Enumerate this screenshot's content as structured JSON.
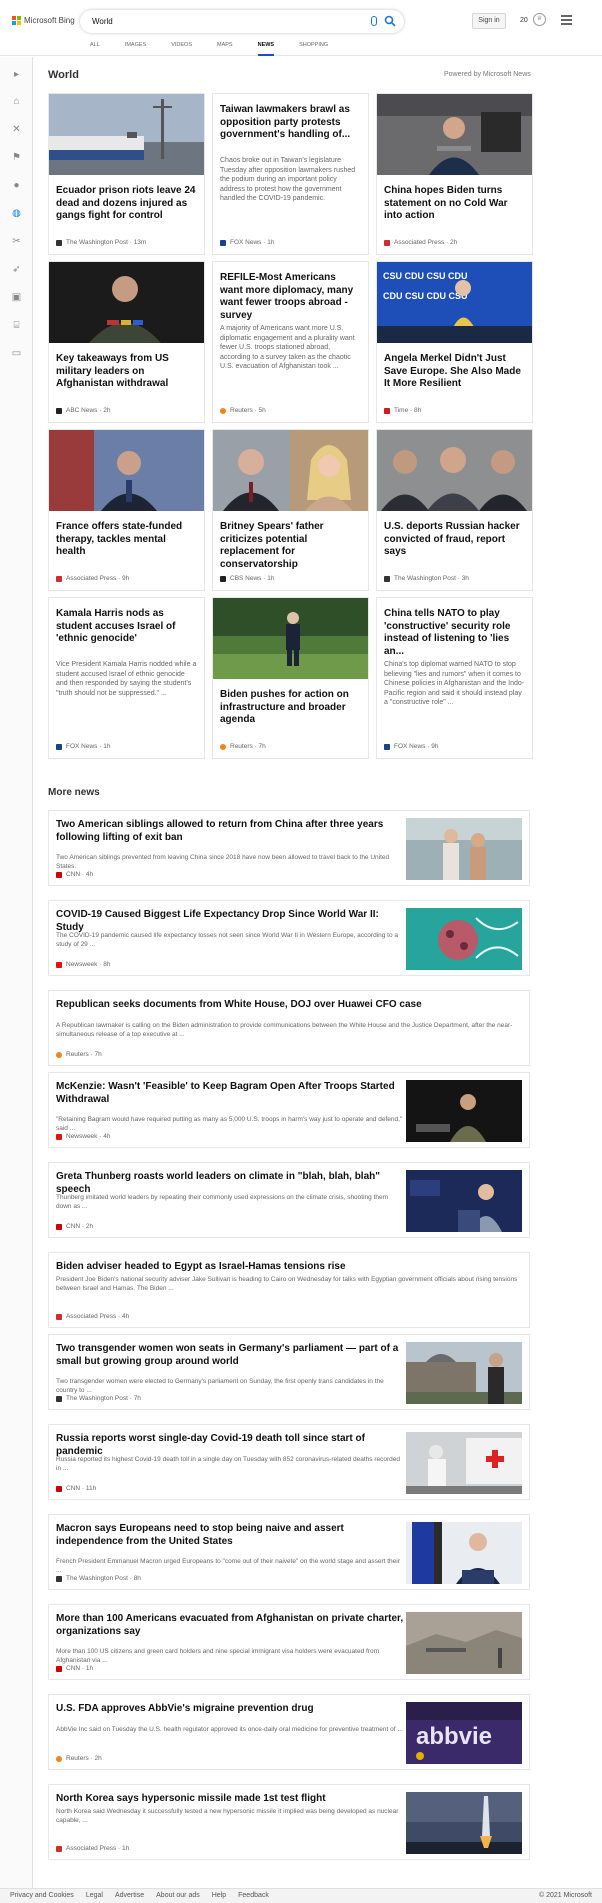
{
  "header": {
    "logo_text": "Microsoft Bing",
    "search_value": "World",
    "signin_label": "Sign in",
    "rewards_count": "20",
    "tabs": [
      {
        "label": "ALL"
      },
      {
        "label": "IMAGES"
      },
      {
        "label": "VIDEOS"
      },
      {
        "label": "MAPS"
      },
      {
        "label": "NEWS"
      },
      {
        "label": "SHOPPING"
      }
    ]
  },
  "section": {
    "title": "World",
    "powered_by": "Powered by Microsoft News",
    "more_title": "More news"
  },
  "top_cards": [
    {
      "headline": "Ecuador prison riots leave 24 dead and dozens injured as gangs fight for control",
      "snippet": "",
      "source": "The Washington Post",
      "time": "13m"
    },
    {
      "headline": "Taiwan lawmakers brawl as opposition party protests government's handling of...",
      "snippet": "Chaos broke out in Taiwan's legislature Tuesday after opposition lawmakers rushed the podium during an important policy address to protest how the government handled the COVID-19 pandemic.",
      "source": "FOX News",
      "time": "1h"
    },
    {
      "headline": "China hopes Biden turns statement on no Cold War into action",
      "snippet": "",
      "source": "Associated Press",
      "time": "2h"
    },
    {
      "headline": "Key takeaways from US military leaders on Afghanistan withdrawal",
      "snippet": "",
      "source": "ABC News",
      "time": "2h"
    },
    {
      "headline": "REFILE-Most Americans want more diplomacy, many want fewer troops abroad -survey",
      "snippet": "A majority of Americans want more U.S. diplomatic engagement and a plurality want fewer U.S. troops stationed abroad, according to a survey taken as the chaotic U.S. evacuation of Afghanistan took ...",
      "source": "Reuters",
      "time": "5h"
    },
    {
      "headline": "Angela Merkel Didn't Just Save Europe. She Also Made It More Resilient",
      "snippet": "",
      "source": "Time",
      "time": "8h"
    },
    {
      "headline": "France offers state-funded therapy, tackles mental health",
      "snippet": "",
      "source": "Associated Press",
      "time": "9h"
    },
    {
      "headline": "Britney Spears' father criticizes potential replacement for conservatorship",
      "snippet": "",
      "source": "CBS News",
      "time": "1h"
    },
    {
      "headline": "U.S. deports Russian hacker convicted of fraud, report says",
      "snippet": "",
      "source": "The Washington Post",
      "time": "3h"
    },
    {
      "headline": "Kamala Harris nods as student accuses Israel of 'ethnic genocide'",
      "snippet": "Vice President Kamala Harris nodded while a student accused Israel of ethnic genocide and then responded by saying the student's \"truth should not be suppressed.\" ...",
      "source": "FOX News",
      "time": "1h"
    },
    {
      "headline": "Biden pushes for action on infrastructure and broader agenda",
      "snippet": "",
      "source": "Reuters",
      "time": "7h"
    },
    {
      "headline": "China tells NATO to play 'constructive' security role instead of listening to 'lies an...",
      "snippet": "China's top diplomat warned NATO to stop believing \"lies and rumors\" when it comes to Chinese policies in Afghanistan and the Indo-Pacific region and said it should instead play a \"constructive role\" ...",
      "source": "FOX News",
      "time": "9h"
    }
  ],
  "more_news": [
    {
      "headline": "Two American siblings allowed to return from China after three years following lifting of exit ban",
      "snippet": "Two American siblings prevented from leaving China since 2018 have now been allowed to travel back to the United States.",
      "source": "CNN",
      "time": "4h"
    },
    {
      "headline": "COVID-19 Caused Biggest Life Expectancy Drop Since World War II: Study",
      "snippet": "The COVID-19 pandemic caused life expectancy losses not seen since World War II in Western Europe, according to a study of 29 ...",
      "source": "Newsweek",
      "time": "8h"
    },
    {
      "headline": "Republican seeks documents from White House, DOJ over Huawei CFO case",
      "snippet": "A Republican lawmaker is calling on the Biden administration to provide communications between the White House and the Justice Department, after the near-simultaneous release of a top executive at ...",
      "source": "Reuters",
      "time": "7h"
    },
    {
      "headline": "McKenzie: Wasn't 'Feasible' to Keep Bagram Open After Troops Started Withdrawal",
      "snippet": "\"Retaining Bagram would have required putting as many as 5,000 U.S. troops in harm's way just to operate and defend,\" said ...",
      "source": "Newsweek",
      "time": "4h"
    },
    {
      "headline": "Greta Thunberg roasts world leaders on climate in \"blah, blah, blah\" speech",
      "snippet": "Thunberg imitated world leaders by repeating their commonly used expressions on the climate crisis, shooting them down as ...",
      "source": "CNN",
      "time": "2h"
    },
    {
      "headline": "Biden adviser headed to Egypt as Israel-Hamas tensions rise",
      "snippet": "President Joe Biden's national security adviser Jake Sullivan is heading to Cairo on Wednesday for talks with Egyptian government officials about rising tensions between Israel and Hamas. The Biden ...",
      "source": "Associated Press",
      "time": "4h"
    },
    {
      "headline": "Two transgender women won seats in Germany's parliament — part of a small but growing group around world",
      "snippet": "Two transgender women were elected to Germany's parliament on Sunday, the first openly trans candidates in the country to ...",
      "source": "The Washington Post",
      "time": "7h"
    },
    {
      "headline": "Russia reports worst single-day Covid-19 death toll since start of pandemic",
      "snippet": "Russia reported its highest Covid-19 death toll in a single day on Tuesday with 852 coronavirus-related deaths recorded in ...",
      "source": "CNN",
      "time": "11h"
    },
    {
      "headline": "Macron says Europeans need to stop being naive and assert independence from the United States",
      "snippet": "French President Emmanuel Macron urged Europeans to \"come out of their naivete\" on the world stage and assert their ...",
      "source": "The Washington Post",
      "time": "8h"
    },
    {
      "headline": "More than 100 Americans evacuated from Afghanistan on private charter, organizations say",
      "snippet": "More than 100 US citizens and green card holders and nine special immigrant visa holders were evacuated from Afghanistan via ...",
      "source": "CNN",
      "time": "1h"
    },
    {
      "headline": "U.S. FDA approves AbbVie's migraine prevention drug",
      "snippet": "AbbVie Inc said on Tuesday the U.S. health regulator approved its once-daily oral medicine for preventive treatment of ...",
      "source": "Reuters",
      "time": "2h"
    },
    {
      "headline": "North Korea says hypersonic missile made 1st test flight",
      "snippet": "North Korea said Wednesday it successfully tested a new hypersonic missile it implied was being developed as nuclear capable, ...",
      "source": "Associated Press",
      "time": "1h"
    }
  ],
  "footer": {
    "links": [
      "Privacy and Cookies",
      "Legal",
      "Advertise",
      "About our ads",
      "Help",
      "Feedback"
    ],
    "copyright": "© 2021 Microsoft"
  },
  "icons": {
    "source_colors": {
      "The Washington Post": "#333333",
      "FOX News": "#1d3f8f",
      "Associated Press": "#d22d2d",
      "ABC News": "#222222",
      "Reuters": "#f58220",
      "Time": "#d31a1a",
      "CBS News": "#222222",
      "CNN": "#cc0000",
      "Newsweek": "#e3120b"
    },
    "accent": "#174ae4"
  }
}
